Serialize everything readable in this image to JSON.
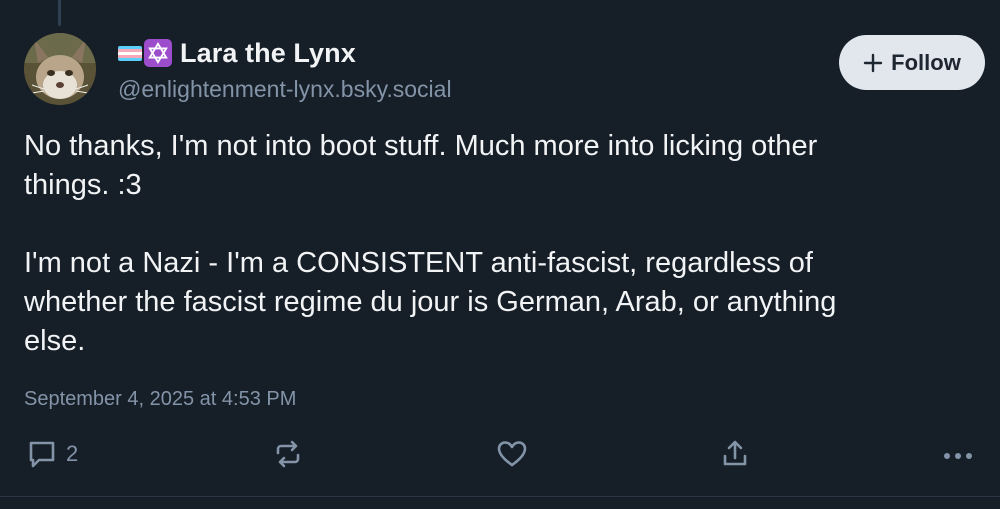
{
  "post": {
    "author": {
      "display_name": "Lara the Lynx",
      "handle": "@enlightenment-lynx.bsky.social",
      "badges": [
        "transgender-flag-icon",
        "star-of-david-icon"
      ],
      "avatar": "lynx-avatar"
    },
    "follow_label": "Follow",
    "text": "No thanks, I'm not into boot stuff. Much more into licking other\nthings. :3\n\nI'm not a Nazi - I'm a CONSISTENT anti-fascist, regardless of\nwhether the fascist regime du jour is German, Arab, or anything\nelse.",
    "timestamp": "September 4, 2025 at 4:53 PM",
    "actions": {
      "reply_count": "2",
      "reply_icon": "reply-icon",
      "repost_icon": "repost-icon",
      "like_icon": "heart-icon",
      "share_icon": "share-icon",
      "more_icon": "more-icon"
    }
  },
  "colors": {
    "background": "#161e27",
    "text": "#f1f3f5",
    "muted": "#8394a8",
    "button_bg": "#e2e7ee",
    "badge_purple": "#9c4dcc"
  }
}
